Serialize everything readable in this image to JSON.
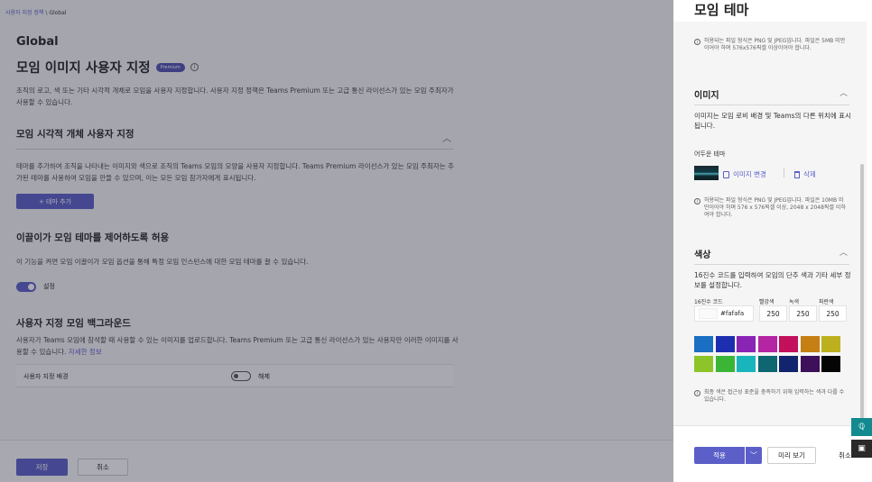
{
  "breadcrumb": {
    "parent": "사용자 지정 정책",
    "separator": " \\ ",
    "current": "Global"
  },
  "background": {
    "title": "Global",
    "heading": "모임 이미지 사용자 지정",
    "premium_badge": "Premium",
    "intro": "조직의 로고, 색 또는 기타 시각적 개체로 모임을 사용자 지정합니다. 사용자 지정 정책은 Teams Premium 또는 고급 통신 라이선스가 있는 모임 주최자가 사용할 수 있습니다.",
    "visual_section": {
      "title": "모임 시각적 개체 사용자 지정",
      "description": "테마를 추가하여 조직을 나타내는 이미지와 색으로 조직의 Teams 모임의 모양을 사용자 지정합니다. Teams Premium 라이선스가 있는 모임 주최자는 추가된 테마를 사용하여 모임을 만들 수 있으며, 이는 모든 모임 참가자에게 표시됩니다.",
      "add_theme_label": "+ 테마 추가"
    },
    "organizer_section": {
      "title": "이끌이가 모임 테마를 제어하도록 허용",
      "description": "이 기능을 켜면 모임 이끌이가 모임 옵션을 통해 특정 모임 인스턴스에 대한 모임 테마를 끌 수 있습니다.",
      "toggle_label": "설정"
    },
    "backgrounds_section": {
      "title": "사용자 지정 모임 백그라운드",
      "description": "사용자가 Teams 모임에 참석할 때 사용할 수 있는 이미지를 업로드합니다. Teams Premium 또는 고급 통신 라이선스가 있는 사용자만 이러한 이미지를 사용할 수 있습니다.",
      "learn_more": "자세한 정보",
      "row_label": "사용자 지정 배경",
      "toggle_label": "해제"
    },
    "footer": {
      "save": "저장",
      "cancel": "취소"
    }
  },
  "panel": {
    "title": "모임 테마",
    "logo_note": "허용되는 파일 형식은 PNG 및 JPEG입니다. 파일은 5MB 미만이어야 하며 576x576픽셀 이상이어야 합니다.",
    "image_section": {
      "title": "이미지",
      "description": "이미지는 모임 로비 배경 및 Teams의 다른 위치에 표시됩니다.",
      "dark_theme_label": "어두운 테마",
      "change_image": "이미지 변경",
      "delete": "삭제",
      "note": "허용되는 파일 형식은 PNG 및 JPEG입니다. 파일은 10MB 미만이어야 하며 576 x 576픽셀 이상, 2048 x 2048픽셀 이하여야 합니다."
    },
    "color_section": {
      "title": "색상",
      "description": "16진수 코드를 입력하여 모임의 단추 색과 기타 세부 정보를 설정합니다.",
      "hex_label": "16진수 코드",
      "red_label": "빨강색",
      "green_label": "녹색",
      "blue_label": "파란색",
      "hex_value": "#fafafa",
      "red": "250",
      "green": "250",
      "blue": "250",
      "palette": [
        "#1a6fc2",
        "#1d2fb0",
        "#8a24b5",
        "#b524a3",
        "#c2105d",
        "#c57f12",
        "#bdb01e",
        "#8dc429",
        "#3ab535",
        "#18b5bd",
        "#0e6670",
        "#12246d",
        "#3e1059",
        "#050505"
      ],
      "note": "최종 색은 접근성 표준을 충족하기 위해 입력하는 색과 다를 수 있습니다."
    },
    "footer": {
      "apply": "적용",
      "preview": "미리 보기",
      "cancel": "취소"
    }
  }
}
